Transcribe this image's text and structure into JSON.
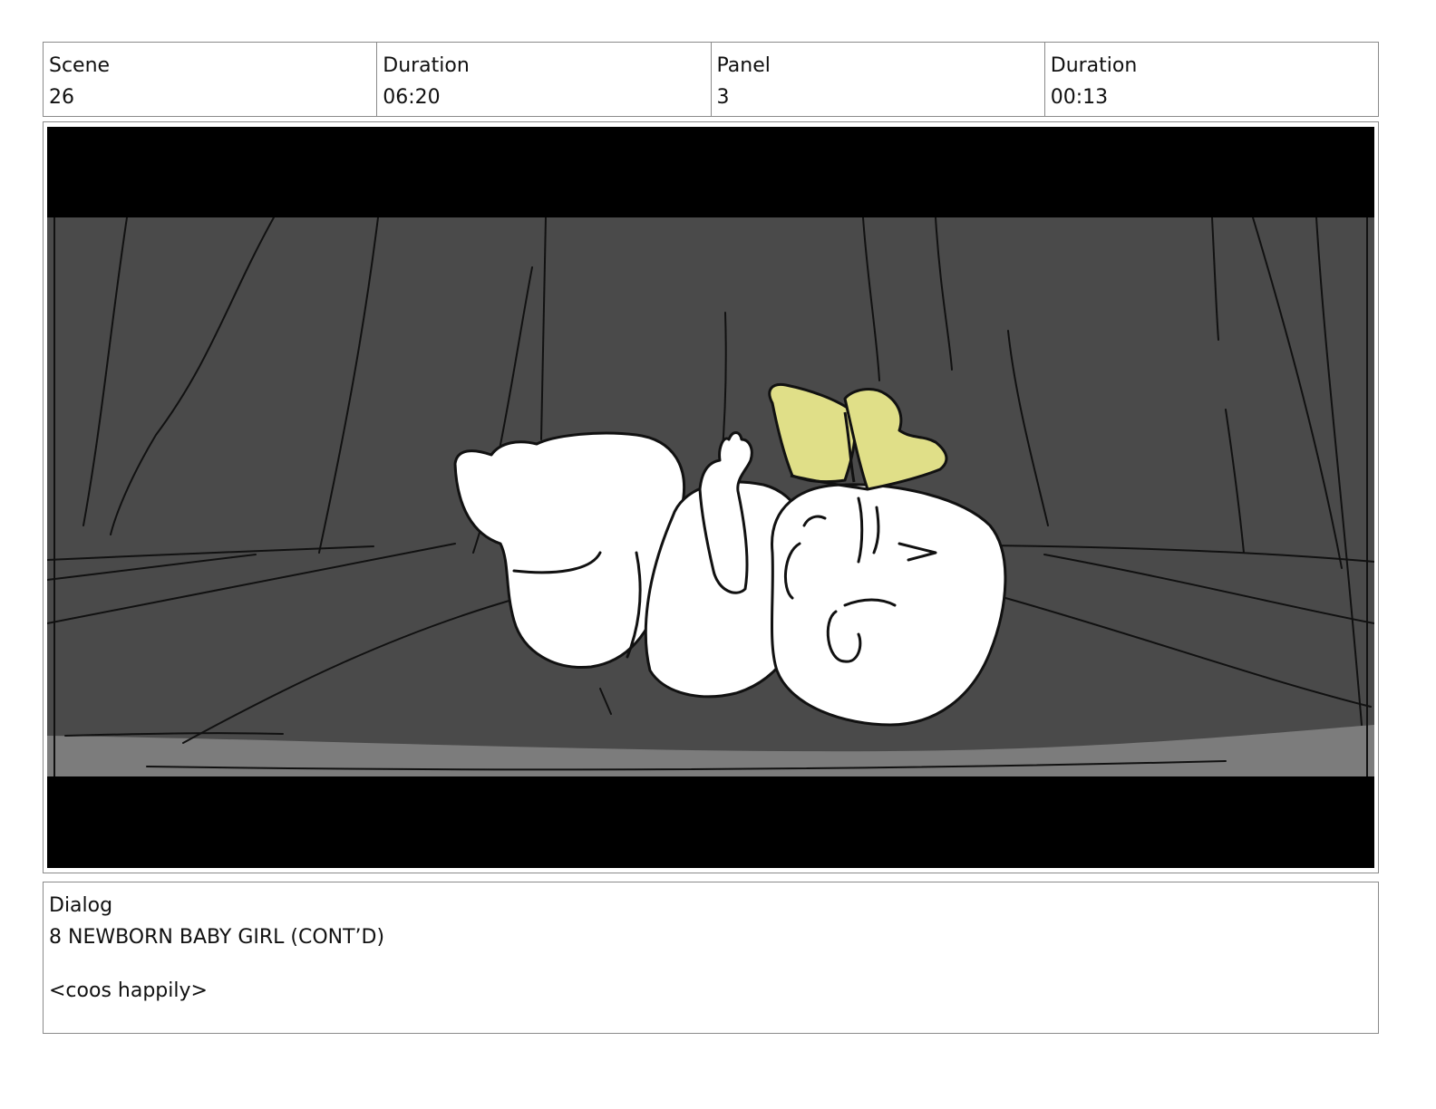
{
  "header": {
    "scene_label": "Scene",
    "scene_value": "26",
    "duration_label": "Duration",
    "duration_value": "06:20",
    "panel_label": "Panel",
    "panel_value": "3",
    "panel_duration_label": "Duration",
    "panel_duration_value": "00:13"
  },
  "panel": {
    "colors": {
      "letterbox": "#000000",
      "background": "#4a4a4a",
      "floor_edge": "#7c7c7c",
      "figure": "#ffffff",
      "bow": "#e0df88",
      "ink": "#111111"
    }
  },
  "dialog": {
    "label": "Dialog",
    "character_line": "8 NEWBORN BABY GIRL (CONT’D)",
    "direction_line": "<coos happily>"
  }
}
